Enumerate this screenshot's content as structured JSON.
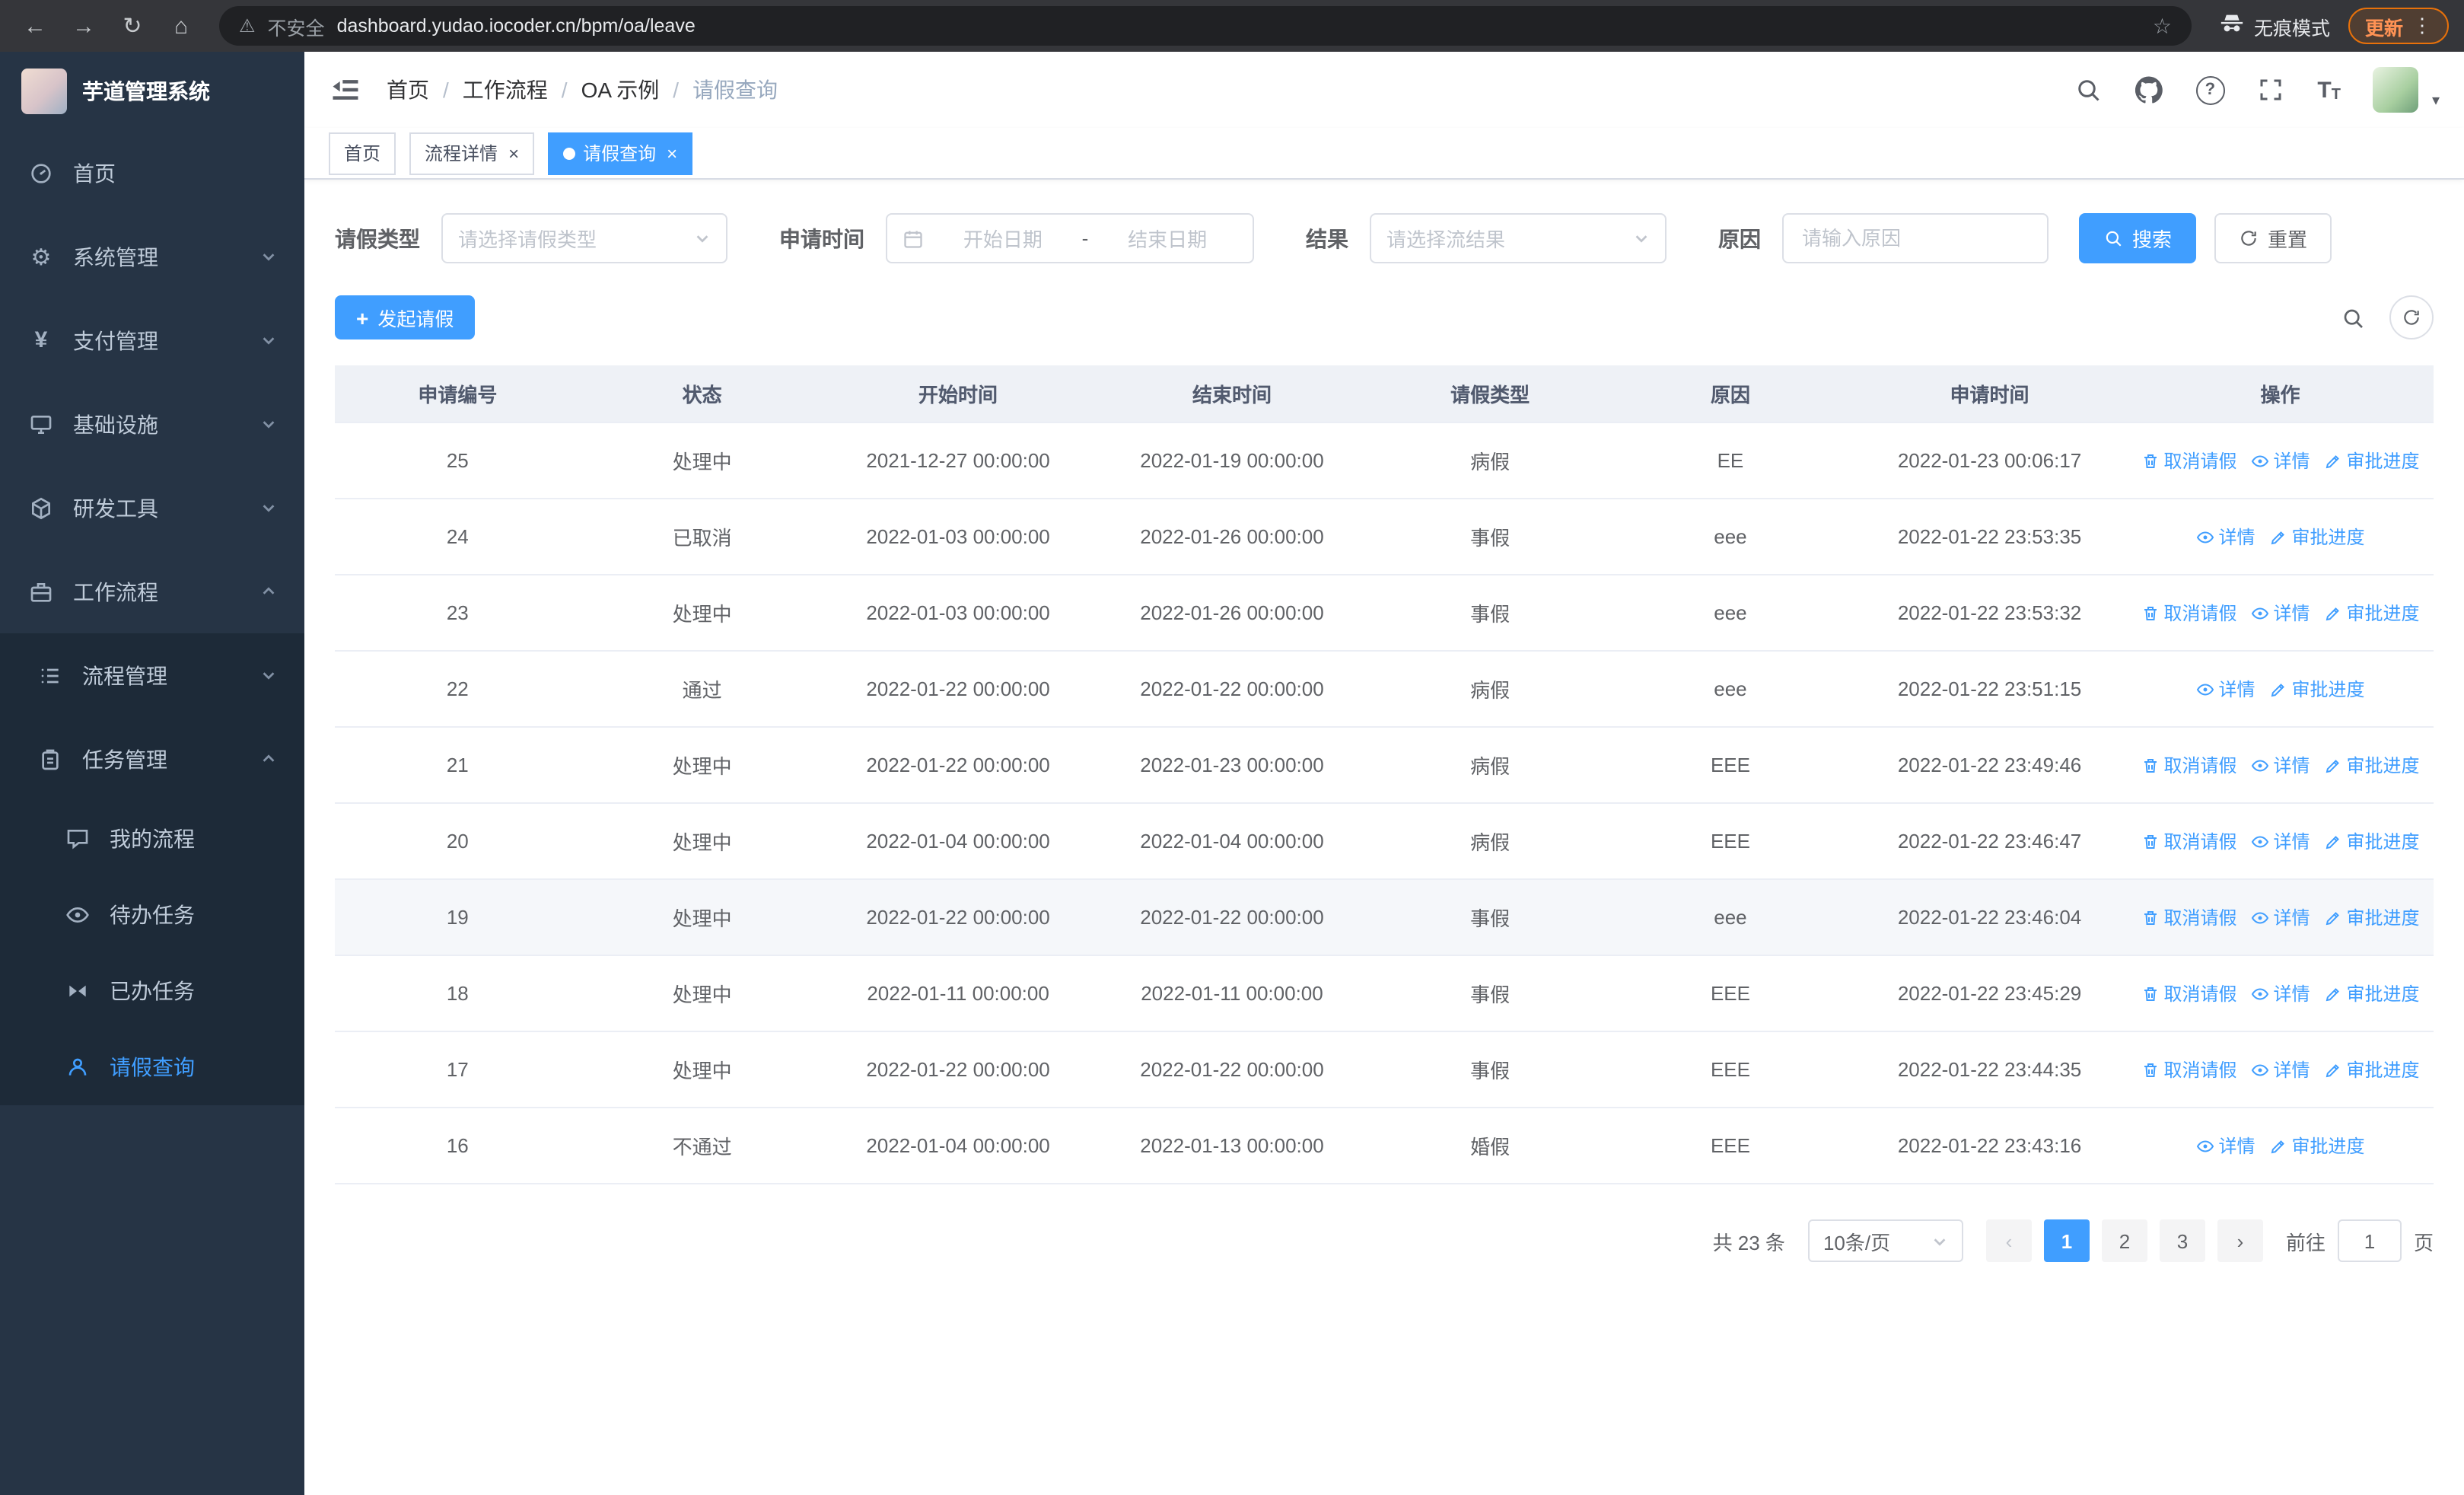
{
  "colors": {
    "accent": "#409eff",
    "sidebar_bg": "#263445",
    "submenu_bg": "#1d2a38",
    "chrome_bg": "#35363a",
    "omnibox_bg": "#202124",
    "update_orange": "#e8710a",
    "table_header_bg": "#eef1f6"
  },
  "browser": {
    "security_label": "不安全",
    "url": "dashboard.yudao.iocoder.cn/bpm/oa/leave",
    "incognito_label": "无痕模式",
    "update_label": "更新"
  },
  "icons": {
    "back": "←",
    "forward": "→",
    "reload": "↻",
    "home": "⌂",
    "warning": "⚠",
    "star": "☆",
    "menu_dots": "⋮",
    "gear": "⚙",
    "yen": "¥",
    "plus": "+",
    "question": "?",
    "font_large": "T",
    "font_small": "T",
    "close": "×",
    "prev": "‹",
    "next": "›",
    "caret_down": "▾",
    "range_separator": "-"
  },
  "sidebar": {
    "app_title": "芋道管理系统",
    "items": [
      {
        "label": "首页"
      },
      {
        "label": "系统管理"
      },
      {
        "label": "支付管理"
      },
      {
        "label": "基础设施"
      },
      {
        "label": "研发工具"
      },
      {
        "label": "工作流程"
      },
      {
        "label": "流程管理"
      },
      {
        "label": "任务管理"
      },
      {
        "label": "我的流程"
      },
      {
        "label": "待办任务"
      },
      {
        "label": "已办任务"
      },
      {
        "label": "请假查询"
      }
    ]
  },
  "breadcrumb": {
    "separator": "/",
    "items": [
      "首页",
      "工作流程",
      "OA 示例",
      "请假查询"
    ]
  },
  "tabs": [
    {
      "label": "首页"
    },
    {
      "label": "流程详情"
    },
    {
      "label": "请假查询"
    }
  ],
  "filters": {
    "leave_type_label": "请假类型",
    "leave_type_placeholder": "请选择请假类型",
    "apply_time_label": "申请时间",
    "start_placeholder": "开始日期",
    "end_placeholder": "结束日期",
    "result_label": "结果",
    "result_placeholder": "请选择流结果",
    "reason_label": "原因",
    "reason_placeholder": "请输入原因",
    "search_label": "搜索",
    "reset_label": "重置"
  },
  "toolbar": {
    "create_label": "发起请假"
  },
  "table": {
    "columns": [
      "申请编号",
      "状态",
      "开始时间",
      "结束时间",
      "请假类型",
      "原因",
      "申请时间",
      "操作"
    ],
    "actions": {
      "cancel": "取消请假",
      "detail": "详情",
      "progress": "审批进度"
    },
    "rows": [
      {
        "id": "25",
        "status": "处理中",
        "start": "2021-12-27 00:00:00",
        "end": "2022-01-19 00:00:00",
        "type": "病假",
        "reason": "EE",
        "applied": "2022-01-23 00:06:17",
        "can_cancel": true,
        "highlight": false
      },
      {
        "id": "24",
        "status": "已取消",
        "start": "2022-01-03 00:00:00",
        "end": "2022-01-26 00:00:00",
        "type": "事假",
        "reason": "eee",
        "applied": "2022-01-22 23:53:35",
        "can_cancel": false,
        "highlight": false
      },
      {
        "id": "23",
        "status": "处理中",
        "start": "2022-01-03 00:00:00",
        "end": "2022-01-26 00:00:00",
        "type": "事假",
        "reason": "eee",
        "applied": "2022-01-22 23:53:32",
        "can_cancel": true,
        "highlight": false
      },
      {
        "id": "22",
        "status": "通过",
        "start": "2022-01-22 00:00:00",
        "end": "2022-01-22 00:00:00",
        "type": "病假",
        "reason": "eee",
        "applied": "2022-01-22 23:51:15",
        "can_cancel": false,
        "highlight": false
      },
      {
        "id": "21",
        "status": "处理中",
        "start": "2022-01-22 00:00:00",
        "end": "2022-01-23 00:00:00",
        "type": "病假",
        "reason": "EEE",
        "applied": "2022-01-22 23:49:46",
        "can_cancel": true,
        "highlight": false
      },
      {
        "id": "20",
        "status": "处理中",
        "start": "2022-01-04 00:00:00",
        "end": "2022-01-04 00:00:00",
        "type": "病假",
        "reason": "EEE",
        "applied": "2022-01-22 23:46:47",
        "can_cancel": true,
        "highlight": false
      },
      {
        "id": "19",
        "status": "处理中",
        "start": "2022-01-22 00:00:00",
        "end": "2022-01-22 00:00:00",
        "type": "事假",
        "reason": "eee",
        "applied": "2022-01-22 23:46:04",
        "can_cancel": true,
        "highlight": true
      },
      {
        "id": "18",
        "status": "处理中",
        "start": "2022-01-11 00:00:00",
        "end": "2022-01-11 00:00:00",
        "type": "事假",
        "reason": "EEE",
        "applied": "2022-01-22 23:45:29",
        "can_cancel": true,
        "highlight": false
      },
      {
        "id": "17",
        "status": "处理中",
        "start": "2022-01-22 00:00:00",
        "end": "2022-01-22 00:00:00",
        "type": "事假",
        "reason": "EEE",
        "applied": "2022-01-22 23:44:35",
        "can_cancel": true,
        "highlight": false
      },
      {
        "id": "16",
        "status": "不通过",
        "start": "2022-01-04 00:00:00",
        "end": "2022-01-13 00:00:00",
        "type": "婚假",
        "reason": "EEE",
        "applied": "2022-01-22 23:43:16",
        "can_cancel": false,
        "highlight": false
      }
    ]
  },
  "pagination": {
    "total_text": "共 23 条",
    "page_size_text": "10条/页",
    "pages": [
      "1",
      "2",
      "3"
    ],
    "active_page": "1",
    "goto_label": "前往",
    "goto_value": "1",
    "goto_suffix": "页"
  }
}
